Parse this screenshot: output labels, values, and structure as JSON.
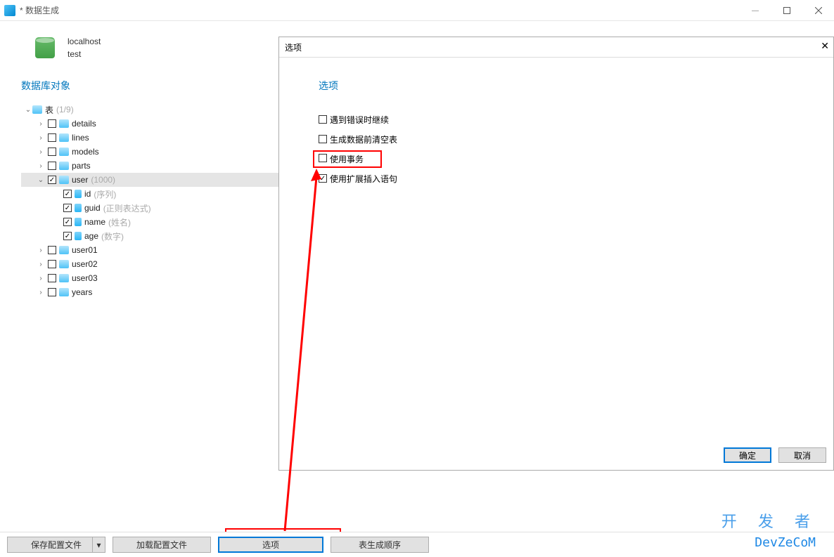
{
  "window": {
    "title": "* 数据生成"
  },
  "connection": {
    "host": "localhost",
    "database": "test"
  },
  "sidebar": {
    "section_label": "数据库对象",
    "root_label": "表",
    "root_suffix": "(1/9)",
    "tables": [
      {
        "name": "details",
        "checked": false
      },
      {
        "name": "lines",
        "checked": false
      },
      {
        "name": "models",
        "checked": false
      },
      {
        "name": "parts",
        "checked": false
      },
      {
        "name": "user",
        "checked": true,
        "suffix": "(1000)",
        "selected": true,
        "columns": [
          {
            "name": "id",
            "suffix": "(序列)"
          },
          {
            "name": "guid",
            "suffix": "(正则表达式)"
          },
          {
            "name": "name",
            "suffix": "(姓名)"
          },
          {
            "name": "age",
            "suffix": "(数字)"
          }
        ]
      },
      {
        "name": "user01",
        "checked": false
      },
      {
        "name": "user02",
        "checked": false
      },
      {
        "name": "user03",
        "checked": false
      },
      {
        "name": "years",
        "checked": false
      }
    ]
  },
  "dialog": {
    "title": "选项",
    "header_label": "选项",
    "options": [
      {
        "label": "遇到错误时继续",
        "checked": false
      },
      {
        "label": "生成数据前清空表",
        "checked": false
      },
      {
        "label": "使用事务",
        "checked": false,
        "highlighted": true
      },
      {
        "label": "使用扩展插入语句",
        "checked": true
      }
    ],
    "ok_label": "确定",
    "cancel_label": "取消"
  },
  "bottom": {
    "save_config": "保存配置文件",
    "load_config": "加载配置文件",
    "options": "选项",
    "gen_order": "表生成顺序"
  },
  "watermark": {
    "top": "开 发 者",
    "sub": "DevZeCoM"
  }
}
